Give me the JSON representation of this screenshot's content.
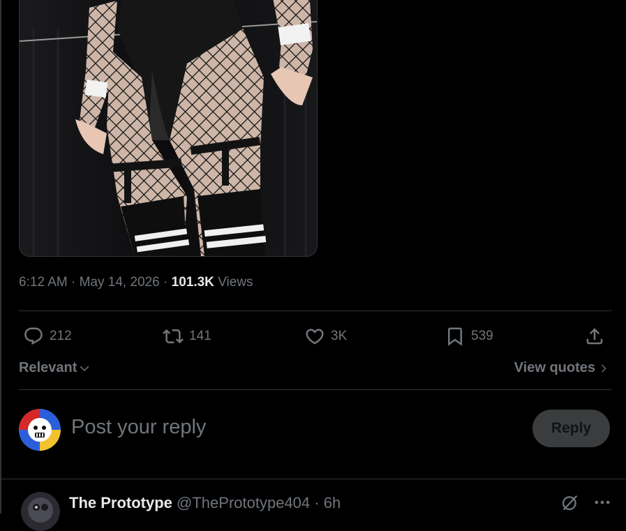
{
  "post": {
    "time": "6:12 AM",
    "separator": "·",
    "date": "May 14, 2026",
    "views_count": "101.3K",
    "views_label": "Views"
  },
  "actions": {
    "replies": "212",
    "reposts": "141",
    "likes": "3K",
    "bookmarks": "539"
  },
  "replies_bar": {
    "sort_label": "Relevant",
    "view_quotes_label": "View quotes"
  },
  "compose": {
    "placeholder": "Post your reply",
    "reply_button_label": "Reply"
  },
  "first_reply": {
    "name": "The Prototype",
    "handle": "@ThePrototype404",
    "separator": "·",
    "time": "6h"
  },
  "icons": {
    "reply": "reply-bubble-icon",
    "repost": "repost-icon",
    "like": "heart-icon",
    "bookmark": "bookmark-icon",
    "share": "share-icon",
    "grok": "grok-icon",
    "more": "more-dots-icon"
  },
  "colors": {
    "background": "#000000",
    "text_primary": "#e7e9ea",
    "text_secondary": "#71767b",
    "divider": "#2f3336",
    "reply_button_bg": "#3a3c3e"
  }
}
